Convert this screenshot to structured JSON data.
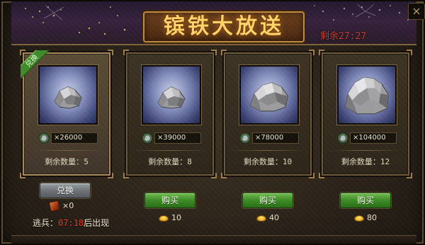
{
  "window": {
    "title": "镔铁大放送",
    "timer_label": "剩余",
    "timer_value": "27:27",
    "close_glyph": "×"
  },
  "cards": [
    {
      "badge": "兑换",
      "quantity": "×26000",
      "remaining_label": "剩余数量：",
      "remaining": "5",
      "ore_size": "small",
      "active": true
    },
    {
      "badge": "",
      "quantity": "×39000",
      "remaining_label": "剩余数量：",
      "remaining": "8",
      "ore_size": "small",
      "active": false
    },
    {
      "badge": "",
      "quantity": "×78000",
      "remaining_label": "剩余数量：",
      "remaining": "10",
      "ore_size": "medium",
      "active": false
    },
    {
      "badge": "",
      "quantity": "×104000",
      "remaining_label": "剩余数量：",
      "remaining": "12",
      "ore_size": "large",
      "active": false
    }
  ],
  "first_card_footer": {
    "exchange_label": "兑换",
    "token_count": "×0",
    "deserter_prefix": "逃兵：",
    "deserter_time": "07:18",
    "deserter_suffix": "后出现"
  },
  "buy_buttons": [
    {
      "label": "购买",
      "cost": "10"
    },
    {
      "label": "购买",
      "cost": "40"
    },
    {
      "label": "购买",
      "cost": "80"
    }
  ],
  "icons": {
    "ore_coin": "ore-coin-icon",
    "gold": "gold-ingot-icon",
    "token": "exchange-token-icon",
    "close": "close-icon"
  },
  "colors": {
    "title": "#ffd26a",
    "timer": "#d23a2a",
    "buy_button": "#3c8a25",
    "exchange_button": "#6d7377",
    "badge": "#3f8a2c"
  }
}
